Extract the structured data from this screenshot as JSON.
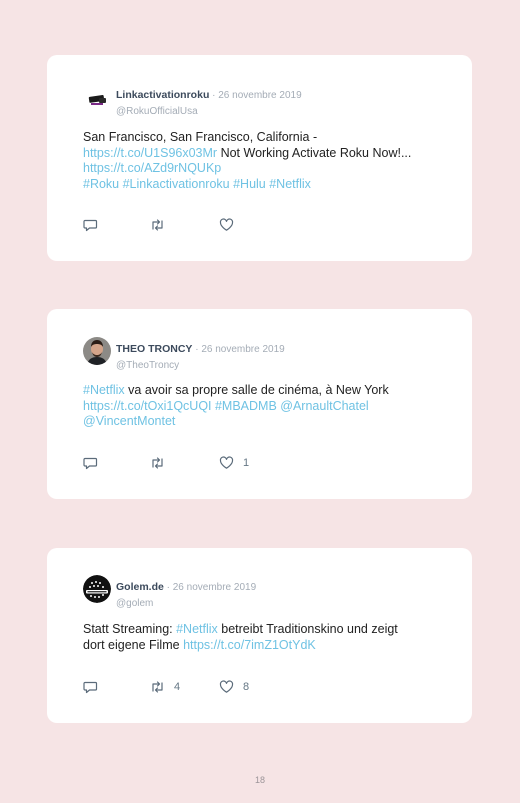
{
  "tweets": [
    {
      "name": "Linkactivationroku",
      "date": "26 novembre 2019",
      "handle": "@RokuOfficialUsa",
      "lines": [
        [
          {
            "t": "San Francisco, San Francisco, California - "
          }
        ],
        [
          {
            "t": "https://t.co/U1S96x03Mr",
            "link": true
          },
          {
            "t": " Not Working Activate Roku Now!..."
          }
        ],
        [
          {
            "t": "https://t.co/AZd9rNQUKp",
            "link": true
          }
        ],
        [
          {
            "t": "#Roku #Linkactivationroku #Hulu #Netflix",
            "link": true
          }
        ]
      ],
      "retweets": "",
      "likes": ""
    },
    {
      "name": "THEO TRONCY",
      "date": "26 novembre 2019",
      "handle": "@TheoTroncy",
      "lines": [
        [
          {
            "t": "#Netflix",
            "link": true
          },
          {
            "t": " va avoir sa propre salle de cinéma, à New York"
          }
        ],
        [
          {
            "t": "https://t.co/tOxi1QcUQI #MBADMB @ArnaultChatel",
            "link": true
          }
        ],
        [
          {
            "t": "@VincentMontet",
            "link": true
          }
        ]
      ],
      "retweets": "",
      "likes": "1"
    },
    {
      "name": "Golem.de",
      "date": "26 novembre 2019",
      "handle": "@golem",
      "lines": [
        [
          {
            "t": "Statt Streaming: "
          },
          {
            "t": "#Netflix",
            "link": true
          },
          {
            "t": " betreibt Traditionskino und zeigt"
          }
        ],
        [
          {
            "t": "dort eigene Filme "
          },
          {
            "t": "https://t.co/7imZ1OtYdK",
            "link": true
          }
        ]
      ],
      "retweets": "4",
      "likes": "8"
    }
  ],
  "page_number": "18",
  "colors": {
    "background": "#f6e4e5",
    "card": "#ffffff",
    "link": "#6fc2e3",
    "name": "#3c4a5c",
    "muted": "#a4acb6",
    "icon": "#5b6b7a"
  },
  "icons": [
    "reply-icon",
    "retweet-icon",
    "like-icon"
  ]
}
